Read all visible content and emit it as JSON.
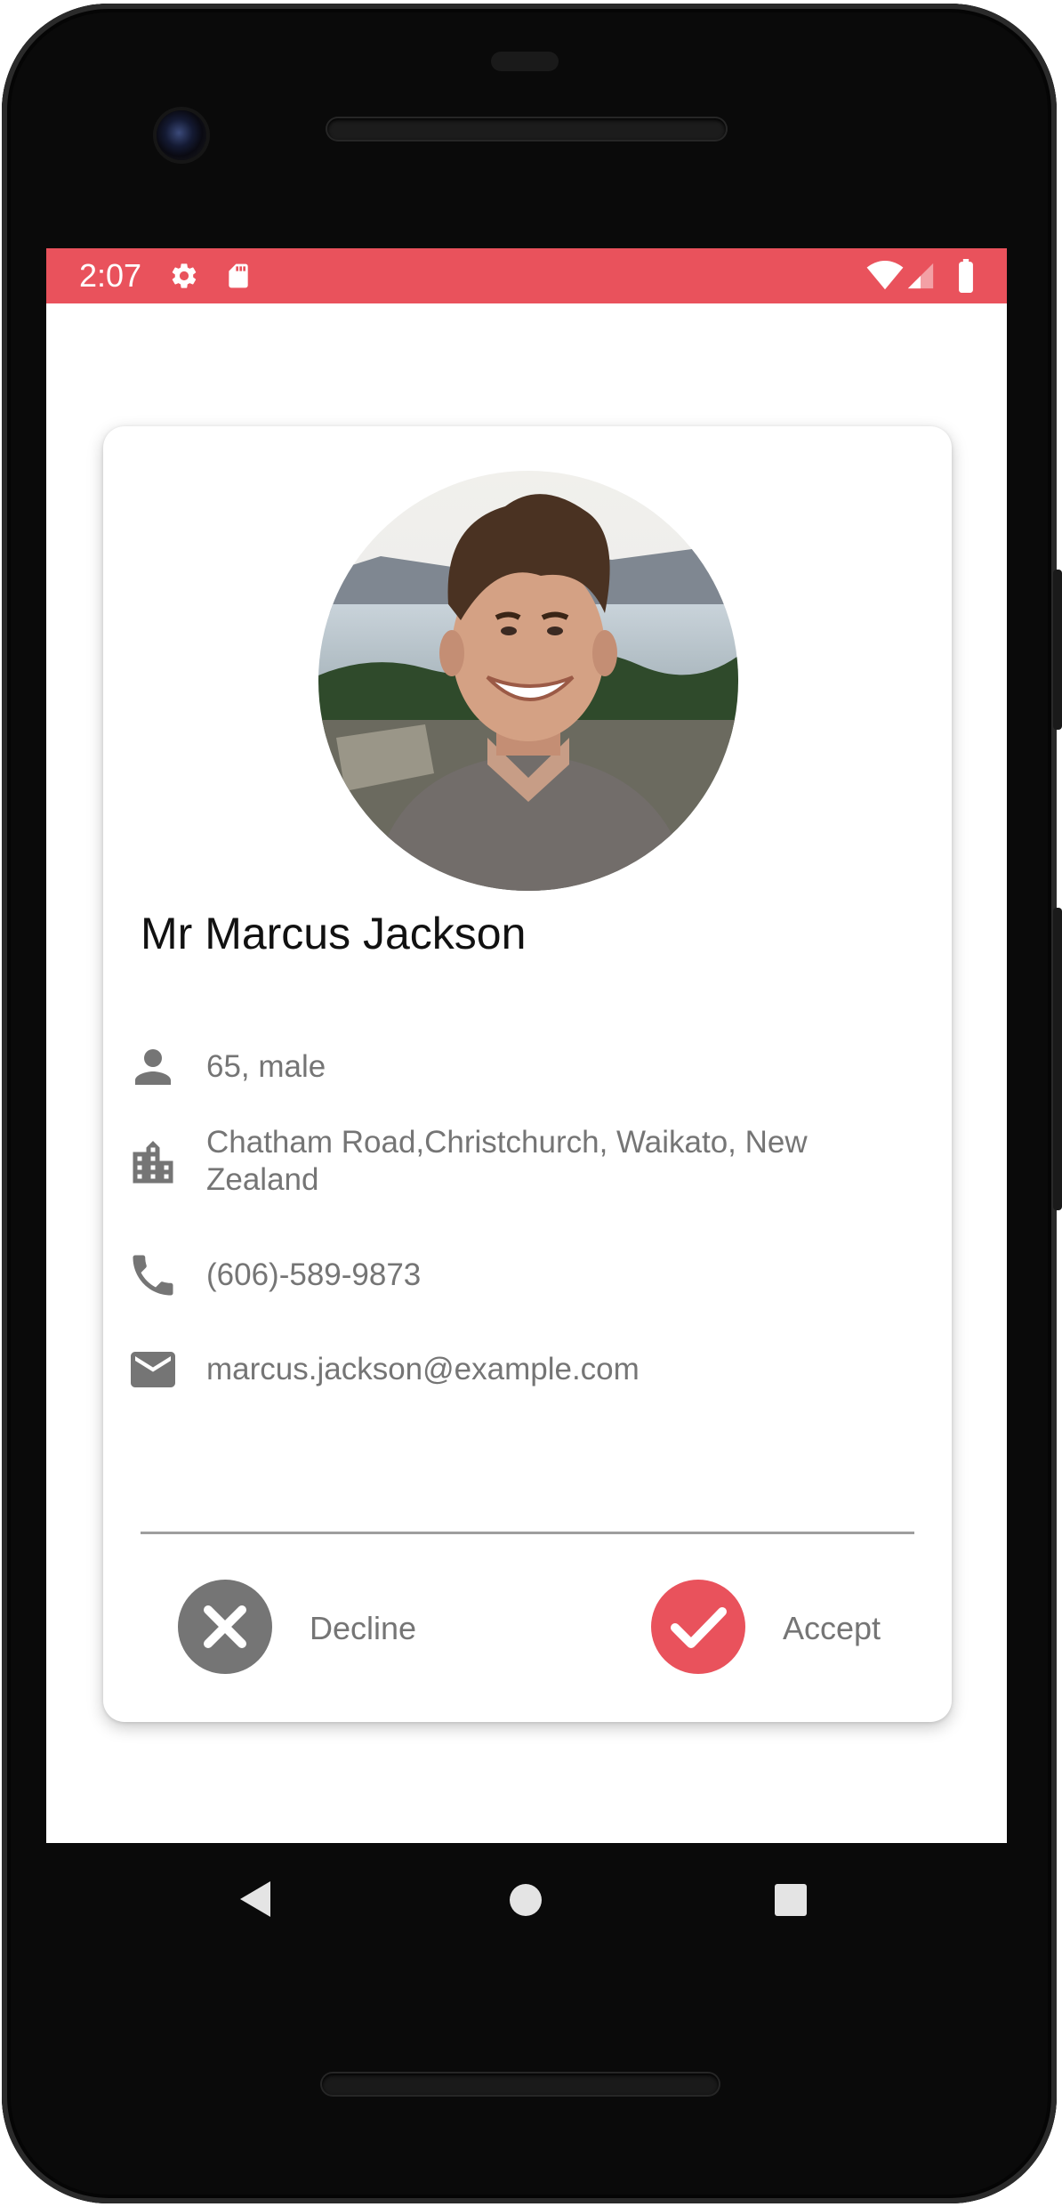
{
  "status_bar": {
    "time": "2:07",
    "icons": [
      "settings-icon",
      "sd-card-icon",
      "wifi-icon",
      "signal-icon",
      "battery-icon"
    ],
    "background_color": "#e9525c"
  },
  "profile": {
    "name": "Mr Marcus Jackson",
    "photo_icon": "profile-photo",
    "details": [
      {
        "icon": "person-icon",
        "text": "65, male"
      },
      {
        "icon": "building-icon",
        "text": "Chatham Road,Christchurch, Waikato, New Zealand"
      },
      {
        "icon": "phone-icon",
        "text": "(606)-589-9873"
      },
      {
        "icon": "email-icon",
        "text": "marcus.jackson@example.com"
      }
    ]
  },
  "actions": {
    "decline": {
      "label": "Decline",
      "icon": "close-icon",
      "color": "#757575"
    },
    "accept": {
      "label": "Accept",
      "icon": "check-icon",
      "color": "#e9525c"
    }
  },
  "navigation": {
    "buttons": [
      "back-icon",
      "home-icon",
      "recents-icon"
    ]
  }
}
